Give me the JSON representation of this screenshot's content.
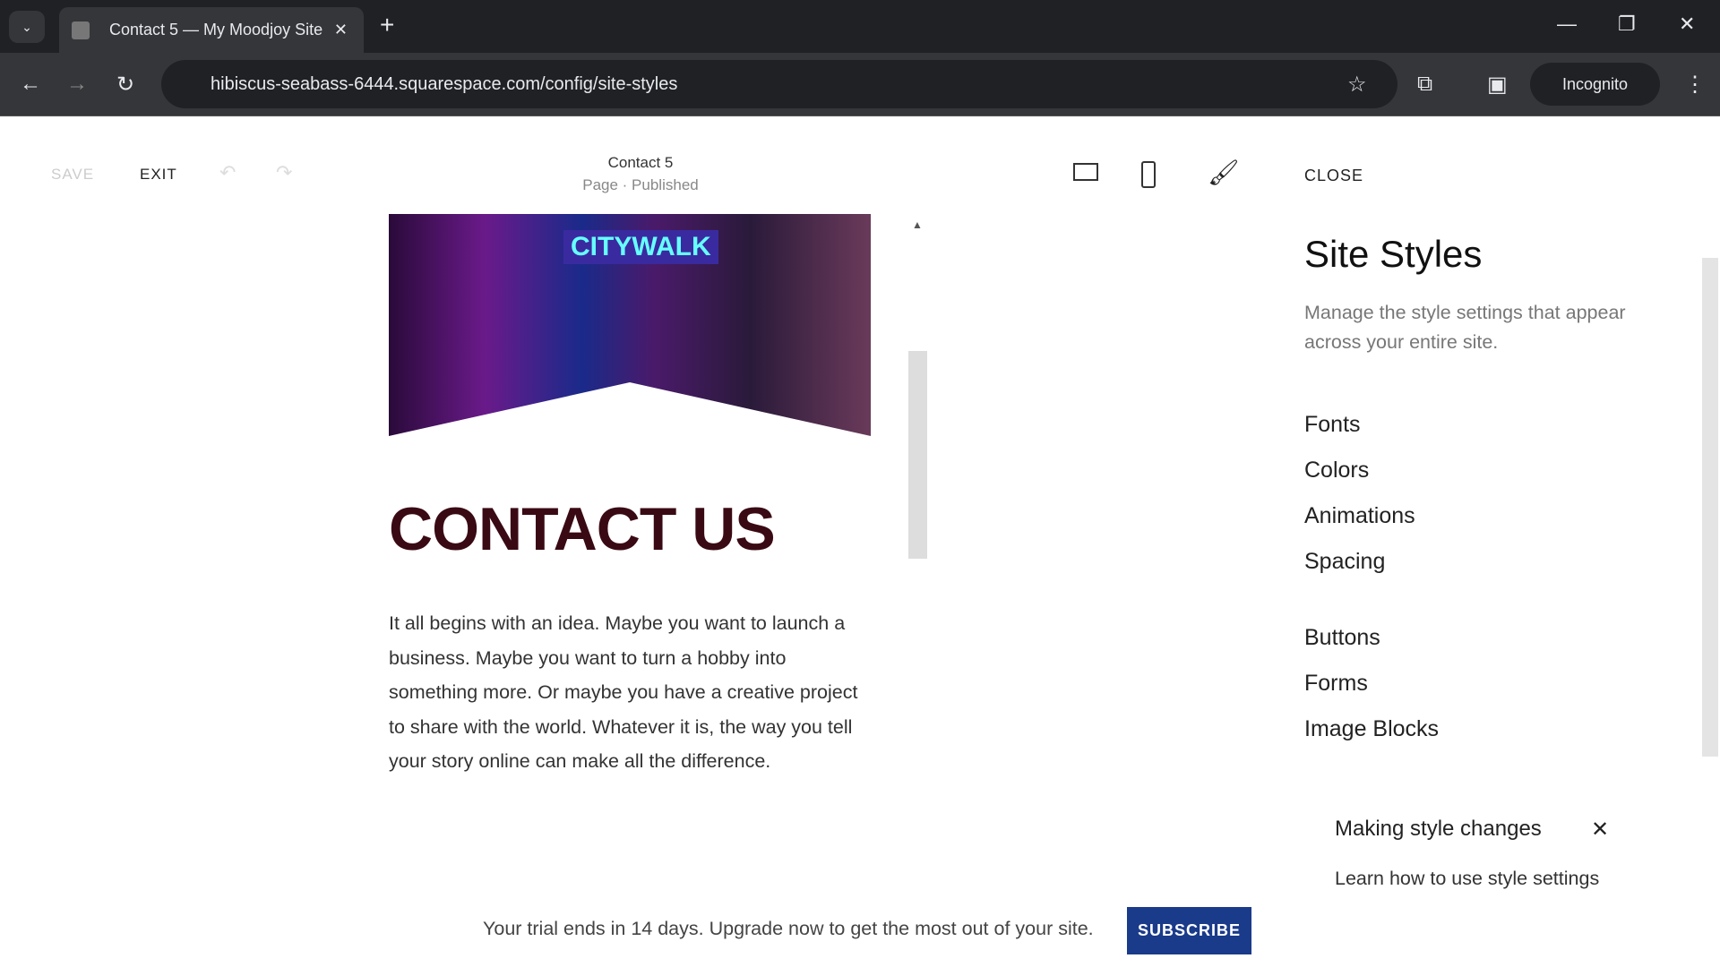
{
  "browser": {
    "tab_title": "Contact 5 — My Moodjoy Site",
    "url": "hibiscus-seabass-6444.squarespace.com/config/site-styles",
    "profile": "Incognito"
  },
  "toolbar": {
    "save": "SAVE",
    "exit": "EXIT",
    "page_title": "Contact 5",
    "page_status": "Page · Published",
    "close": "CLOSE"
  },
  "page": {
    "hero_sign": "CITYWALK",
    "heading": "CONTACT US",
    "body": "It all begins with an idea. Maybe you want to launch a business. Maybe you want to turn a hobby into something more. Or maybe you have a creative project to share with the world. Whatever it is, the way you tell your story online can make all the difference."
  },
  "panel": {
    "title": "Site Styles",
    "description": "Manage the style settings that appear across your entire site.",
    "items": [
      "Fonts",
      "Colors",
      "Animations",
      "Spacing",
      "Buttons",
      "Forms",
      "Image Blocks"
    ],
    "tip_title": "Making style changes",
    "tip_link": "Learn how to use style settings"
  },
  "banner": {
    "text": "Your trial ends in 14 days. Upgrade now to get the most out of your site.",
    "button": "SUBSCRIBE"
  },
  "colors": {
    "heading": "#3a0a14",
    "subscribe": "#1a3a8a"
  }
}
